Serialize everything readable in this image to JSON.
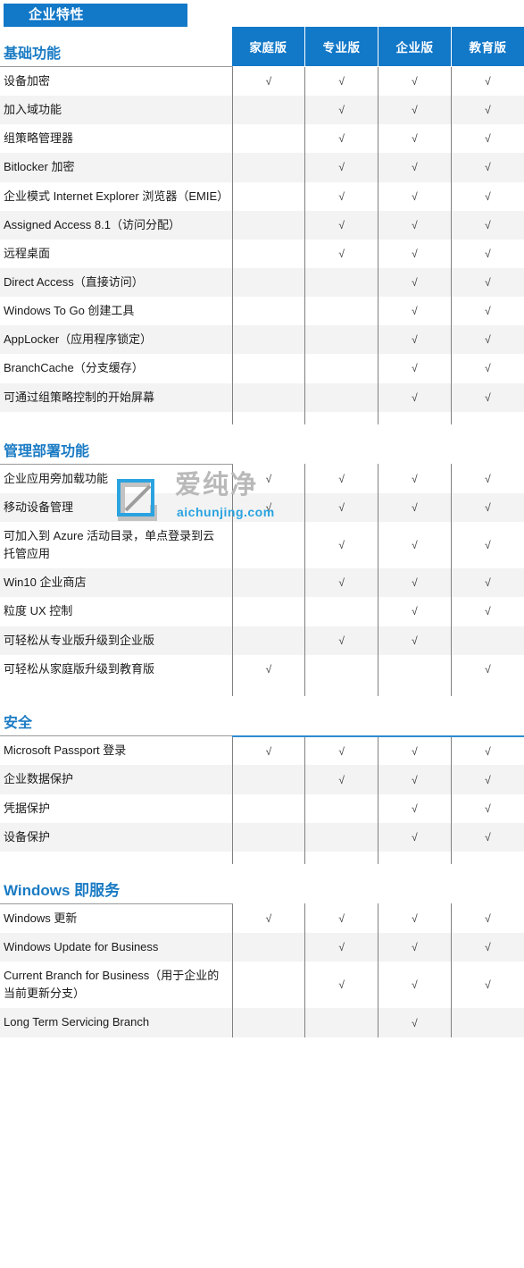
{
  "badge": {
    "label": "企业特性"
  },
  "columns": [
    "家庭版",
    "专业版",
    "企业版",
    "教育版"
  ],
  "check_glyph": "√",
  "colors": {
    "header_blue": "#1278c8",
    "section_title_blue": "#1a7bc4",
    "rule_grey": "#9a9a9a",
    "row_alt": "#f3f3f3",
    "watermark_grey": "#b9b9b9",
    "watermark_blue": "#2aa3e0"
  },
  "watermark": {
    "text": "爱纯净",
    "domain": "aichunjing.com",
    "logo": "aichunjing-logo-icon"
  },
  "sections": [
    {
      "title": "基础功能",
      "has_column_headers": true,
      "rows": [
        {
          "label": "设备加密",
          "checks": [
            true,
            true,
            true,
            true
          ]
        },
        {
          "label": "加入域功能",
          "checks": [
            false,
            true,
            true,
            true
          ]
        },
        {
          "label": "组策略管理器",
          "checks": [
            false,
            true,
            true,
            true
          ]
        },
        {
          "label": "Bitlocker 加密",
          "checks": [
            false,
            true,
            true,
            true
          ]
        },
        {
          "label": "企业模式 Internet Explorer 浏览器（EMIE）",
          "checks": [
            false,
            true,
            true,
            true
          ]
        },
        {
          "label": "Assigned Access 8.1（访问分配）",
          "checks": [
            false,
            true,
            true,
            true
          ]
        },
        {
          "label": "远程桌面",
          "checks": [
            false,
            true,
            true,
            true
          ]
        },
        {
          "label": "Direct Access（直接访问）",
          "checks": [
            false,
            false,
            true,
            true
          ]
        },
        {
          "label": "Windows To Go 创建工具",
          "checks": [
            false,
            false,
            true,
            true
          ]
        },
        {
          "label": "AppLocker（应用程序锁定）",
          "checks": [
            false,
            false,
            true,
            true
          ]
        },
        {
          "label": "BranchCache（分支缓存）",
          "checks": [
            false,
            false,
            true,
            true
          ]
        },
        {
          "label": "可通过组策略控制的开始屏幕",
          "checks": [
            false,
            false,
            true,
            true
          ]
        }
      ]
    },
    {
      "title": "管理部署功能",
      "has_column_headers": false,
      "rows": [
        {
          "label": "企业应用旁加载功能",
          "checks": [
            true,
            true,
            true,
            true
          ]
        },
        {
          "label": "移动设备管理",
          "checks": [
            true,
            true,
            true,
            true
          ]
        },
        {
          "label": "可加入到 Azure 活动目录，单点登录到云托管应用",
          "checks": [
            false,
            true,
            true,
            true
          ]
        },
        {
          "label": "Win10 企业商店",
          "checks": [
            false,
            true,
            true,
            true
          ]
        },
        {
          "label": "粒度 UX 控制",
          "checks": [
            false,
            false,
            true,
            true
          ]
        },
        {
          "label": "可轻松从专业版升级到企业版",
          "checks": [
            false,
            true,
            true,
            false
          ]
        },
        {
          "label": "可轻松从家庭版升级到教育版",
          "checks": [
            true,
            false,
            false,
            true
          ]
        }
      ]
    },
    {
      "title": "安全",
      "has_column_headers": false,
      "blue_top_rule": true,
      "rows": [
        {
          "label": "Microsoft Passport 登录",
          "checks": [
            true,
            true,
            true,
            true
          ]
        },
        {
          "label": "企业数据保护",
          "checks": [
            false,
            true,
            true,
            true
          ]
        },
        {
          "label": "凭据保护",
          "checks": [
            false,
            false,
            true,
            true
          ]
        },
        {
          "label": "设备保护",
          "checks": [
            false,
            false,
            true,
            true
          ]
        }
      ]
    },
    {
      "title": "Windows 即服务",
      "has_column_headers": false,
      "rows": [
        {
          "label": "Windows 更新",
          "checks": [
            true,
            true,
            true,
            true
          ]
        },
        {
          "label": "Windows Update for Business",
          "checks": [
            false,
            true,
            true,
            true
          ]
        },
        {
          "label": "Current Branch for Business（用于企业的当前更新分支）",
          "checks": [
            false,
            true,
            true,
            true
          ]
        },
        {
          "label": "Long Term Servicing Branch",
          "checks": [
            false,
            false,
            true,
            false
          ]
        }
      ]
    }
  ]
}
